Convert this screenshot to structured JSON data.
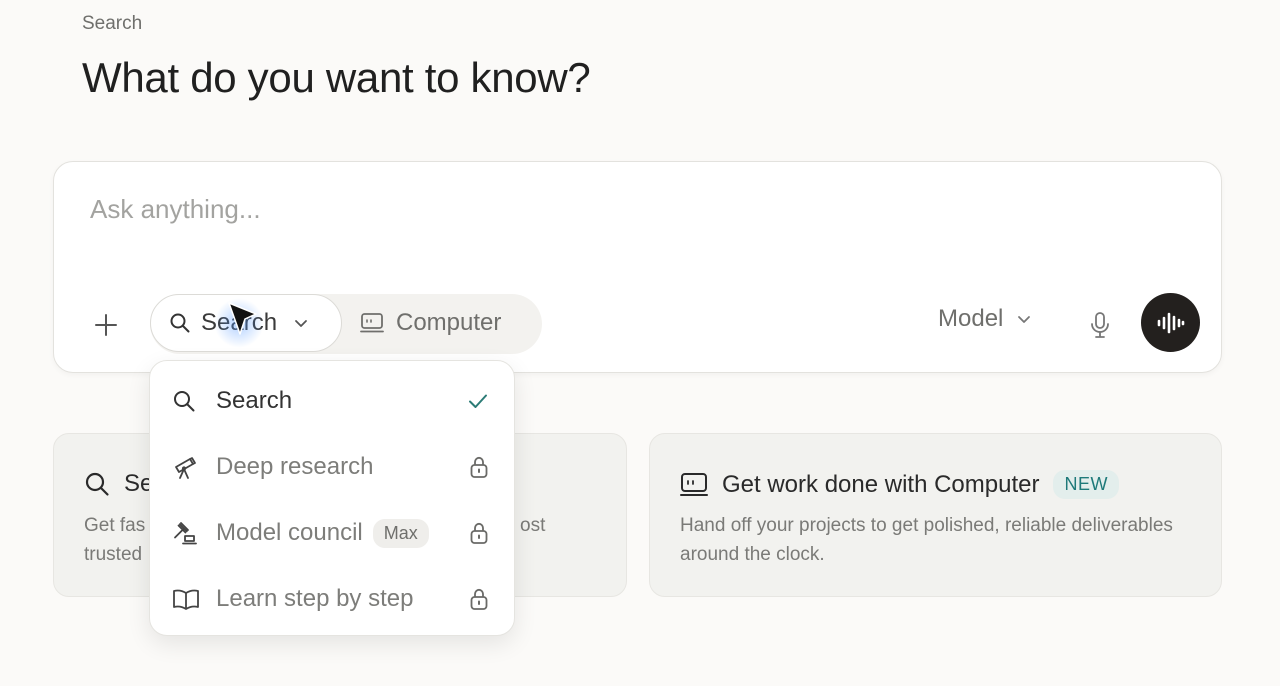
{
  "header": {
    "breadcrumb": "Search",
    "title": "What do you want to know?"
  },
  "composer": {
    "placeholder": "Ask anything...",
    "value": "",
    "modes": {
      "search_label": "Search",
      "computer_label": "Computer"
    },
    "model_label": "Model"
  },
  "dropdown": {
    "items": [
      {
        "label": "Search",
        "icon": "search-icon",
        "state": "selected"
      },
      {
        "label": "Deep research",
        "icon": "telescope-icon",
        "state": "locked"
      },
      {
        "label": "Model council",
        "icon": "gavel-icon",
        "state": "locked",
        "badge": "Max"
      },
      {
        "label": "Learn step by step",
        "icon": "book-open-icon",
        "state": "locked"
      }
    ]
  },
  "cards": {
    "left": {
      "title": "Search",
      "title_visible": "Se",
      "desc_line1_visible": "Get fas",
      "desc_line1_tail": "ost",
      "desc_line2_visible": "trusted"
    },
    "right": {
      "title": "Get work done with Computer",
      "badge": "NEW",
      "description": "Hand off your projects to get polished, reliable deliverables around the clock."
    }
  },
  "colors": {
    "background": "#fbfaf8",
    "voice_button": "#23201e",
    "check_accent": "#2b7b76",
    "new_badge_text": "#1f7a7a"
  }
}
